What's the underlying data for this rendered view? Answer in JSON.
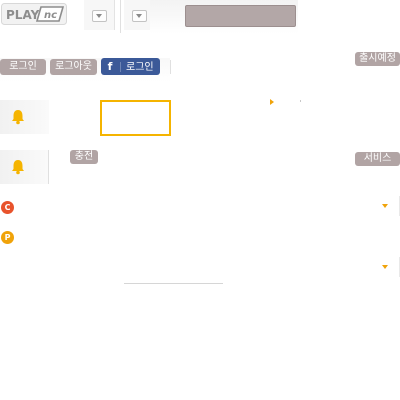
{
  "header": {
    "logo_text": "PLAY NC",
    "dropdowns": [
      {
        "icon": "chevron-down-icon"
      },
      {
        "icon": "chevron-down-icon"
      }
    ]
  },
  "account": {
    "login_label": "로그인",
    "logout_label": "로그아웃",
    "facebook_icon_glyph": "f",
    "facebook_login_label": "로그인"
  },
  "badges": {
    "upcoming_label": "출시예정",
    "charge_label": "충전",
    "service_label": "서비스"
  },
  "icons": {
    "ncoin_glyph": "C",
    "point_glyph": "P"
  },
  "colors": {
    "accent": "#f5b400",
    "pill": "#b1a4a4",
    "facebook": "#3b5998",
    "ncoin": "#e8532c",
    "point": "#f0a30a"
  }
}
